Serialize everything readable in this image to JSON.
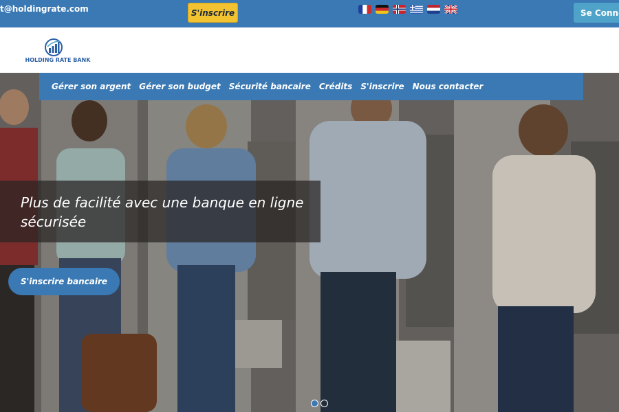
{
  "topbar": {
    "email": "t@holdingrate.com",
    "signup_label": "S'inscrire",
    "login_label": "Se Connec",
    "flags": [
      "flag-fr-icon",
      "flag-de-icon",
      "flag-no-icon",
      "flag-gr-icon",
      "flag-nl-icon",
      "flag-uk-icon"
    ]
  },
  "logo": {
    "name": "HOLDING RATE BANK"
  },
  "nav": {
    "items": [
      "Gérer son argent",
      "Gérer son budget",
      "Sécurité bancaire",
      "Crédits",
      "S'inscrire",
      "Nous contacter"
    ]
  },
  "hero": {
    "headline": "Plus de facilité avec une banque en ligne sécurisée",
    "cta_label": "S'inscrire bancaire",
    "slides_total": 2,
    "active_slide": 1
  },
  "colors": {
    "primary": "#3a79b3",
    "signup_button": "#f2c230",
    "login_button": "#4fa3c9"
  }
}
